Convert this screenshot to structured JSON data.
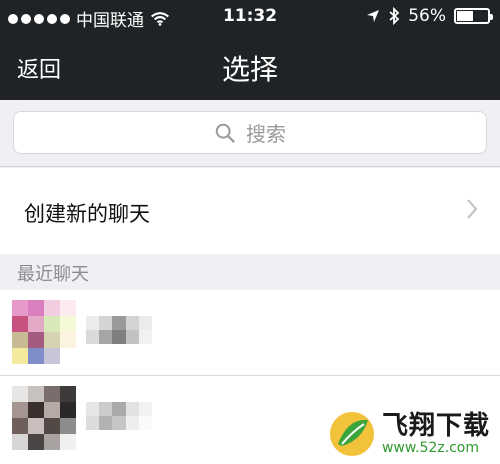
{
  "status_bar": {
    "carrier": "中国联通",
    "time": "11:32",
    "battery_percent": "56%",
    "battery_level": 0.56,
    "icons": [
      "signal-dots-icon",
      "wifi-icon",
      "location-arrow-icon",
      "bluetooth-icon",
      "battery-icon"
    ]
  },
  "nav": {
    "back_label": "返回",
    "title": "选择"
  },
  "search": {
    "placeholder": "搜索",
    "icon": "search-icon"
  },
  "create_chat": {
    "label": "创建新的聊天",
    "icon": "chevron-right-icon"
  },
  "recent": {
    "header": "最近聊天"
  },
  "watermark": {
    "brand": "飞翔下载",
    "url": "www.52z.com"
  },
  "colors": {
    "nav_bg": "#1f2326",
    "page_bg": "#efeff4",
    "accent_green": "#2f9a2f"
  }
}
